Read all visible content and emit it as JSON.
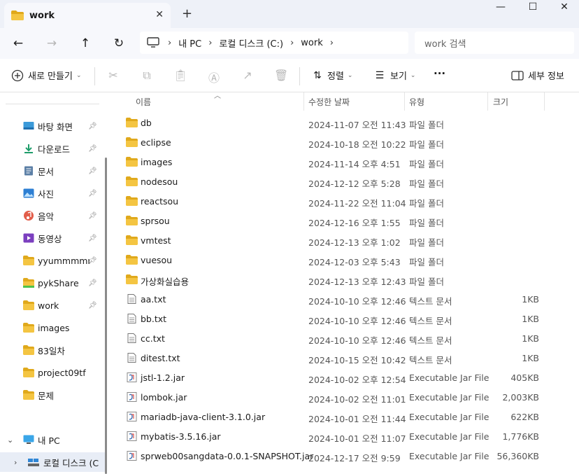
{
  "window": {
    "tab_title": "work",
    "tab_close": "✕",
    "new_tab": "+",
    "minimize": "—",
    "maximize": "☐",
    "close": "✕"
  },
  "address": {
    "back": "←",
    "forward": "→",
    "up": "↑",
    "refresh": "↻",
    "crumbs": [
      "내 PC",
      "로컬 디스크 (C:)",
      "work"
    ],
    "search_placeholder": "work 검색"
  },
  "toolbar": {
    "new_label": "새로 만들기",
    "sort_label": "정렬",
    "view_label": "보기",
    "more_label": "···",
    "details_label": "세부 정보"
  },
  "sidebar": {
    "items": [
      {
        "label": "바탕 화면",
        "icon": "desktop-icon",
        "pinned": true
      },
      {
        "label": "다운로드",
        "icon": "download-icon",
        "pinned": true
      },
      {
        "label": "문서",
        "icon": "document-icon",
        "pinned": true
      },
      {
        "label": "사진",
        "icon": "pictures-icon",
        "pinned": true
      },
      {
        "label": "음악",
        "icon": "music-icon",
        "pinned": true
      },
      {
        "label": "동영상",
        "icon": "video-icon",
        "pinned": true
      },
      {
        "label": "yyummmmmm",
        "icon": "folder-icon",
        "pinned": true
      },
      {
        "label": "pykShare",
        "icon": "folder-icon",
        "pinned": true
      },
      {
        "label": "work",
        "icon": "folder-icon",
        "pinned": true
      },
      {
        "label": "images",
        "icon": "folder-icon",
        "pinned": false
      },
      {
        "label": "83일차",
        "icon": "folder-icon",
        "pinned": false
      },
      {
        "label": "project09tf",
        "icon": "folder-icon",
        "pinned": false
      },
      {
        "label": "문제",
        "icon": "folder-icon",
        "pinned": false
      }
    ],
    "this_pc": "내 PC",
    "local_disk": "로컬 디스크 (C:)"
  },
  "columns": {
    "name": "이름",
    "date": "수정한 날짜",
    "type": "유형",
    "size": "크기"
  },
  "files": [
    {
      "name": "db",
      "date": "2024-11-07 오전 11:43",
      "type": "파일 폴더",
      "size": "",
      "kind": "folder"
    },
    {
      "name": "eclipse",
      "date": "2024-10-18 오전 10:22",
      "type": "파일 폴더",
      "size": "",
      "kind": "folder"
    },
    {
      "name": "images",
      "date": "2024-11-14 오후 4:51",
      "type": "파일 폴더",
      "size": "",
      "kind": "folder"
    },
    {
      "name": "nodesou",
      "date": "2024-12-12 오후 5:28",
      "type": "파일 폴더",
      "size": "",
      "kind": "folder"
    },
    {
      "name": "reactsou",
      "date": "2024-11-22 오전 11:04",
      "type": "파일 폴더",
      "size": "",
      "kind": "folder"
    },
    {
      "name": "sprsou",
      "date": "2024-12-16 오후 1:55",
      "type": "파일 폴더",
      "size": "",
      "kind": "folder"
    },
    {
      "name": "vmtest",
      "date": "2024-12-13 오후 1:02",
      "type": "파일 폴더",
      "size": "",
      "kind": "folder"
    },
    {
      "name": "vuesou",
      "date": "2024-12-03 오후 5:43",
      "type": "파일 폴더",
      "size": "",
      "kind": "folder"
    },
    {
      "name": "가상화실습용",
      "date": "2024-12-13 오후 12:43",
      "type": "파일 폴더",
      "size": "",
      "kind": "folder"
    },
    {
      "name": "aa.txt",
      "date": "2024-10-10 오후 12:46",
      "type": "텍스트 문서",
      "size": "1KB",
      "kind": "txt"
    },
    {
      "name": "bb.txt",
      "date": "2024-10-10 오후 12:46",
      "type": "텍스트 문서",
      "size": "1KB",
      "kind": "txt"
    },
    {
      "name": "cc.txt",
      "date": "2024-10-10 오후 12:46",
      "type": "텍스트 문서",
      "size": "1KB",
      "kind": "txt"
    },
    {
      "name": "ditest.txt",
      "date": "2024-10-15 오전 10:42",
      "type": "텍스트 문서",
      "size": "1KB",
      "kind": "txt"
    },
    {
      "name": "jstl-1.2.jar",
      "date": "2024-10-02 오후 12:54",
      "type": "Executable Jar File",
      "size": "405KB",
      "kind": "jar"
    },
    {
      "name": "lombok.jar",
      "date": "2024-10-02 오전 11:01",
      "type": "Executable Jar File",
      "size": "2,003KB",
      "kind": "jar"
    },
    {
      "name": "mariadb-java-client-3.1.0.jar",
      "date": "2024-10-01 오전 11:44",
      "type": "Executable Jar File",
      "size": "622KB",
      "kind": "jar"
    },
    {
      "name": "mybatis-3.5.16.jar",
      "date": "2024-10-01 오전 11:07",
      "type": "Executable Jar File",
      "size": "1,776KB",
      "kind": "jar"
    },
    {
      "name": "sprweb00sangdata-0.0.1-SNAPSHOT.jar",
      "date": "2024-12-17 오전 9:59",
      "type": "Executable Jar File",
      "size": "56,360KB",
      "kind": "jar"
    }
  ],
  "colors": {
    "folder": "#f4c542",
    "folder_dark": "#e0a91c",
    "accent": "#0067c0"
  }
}
